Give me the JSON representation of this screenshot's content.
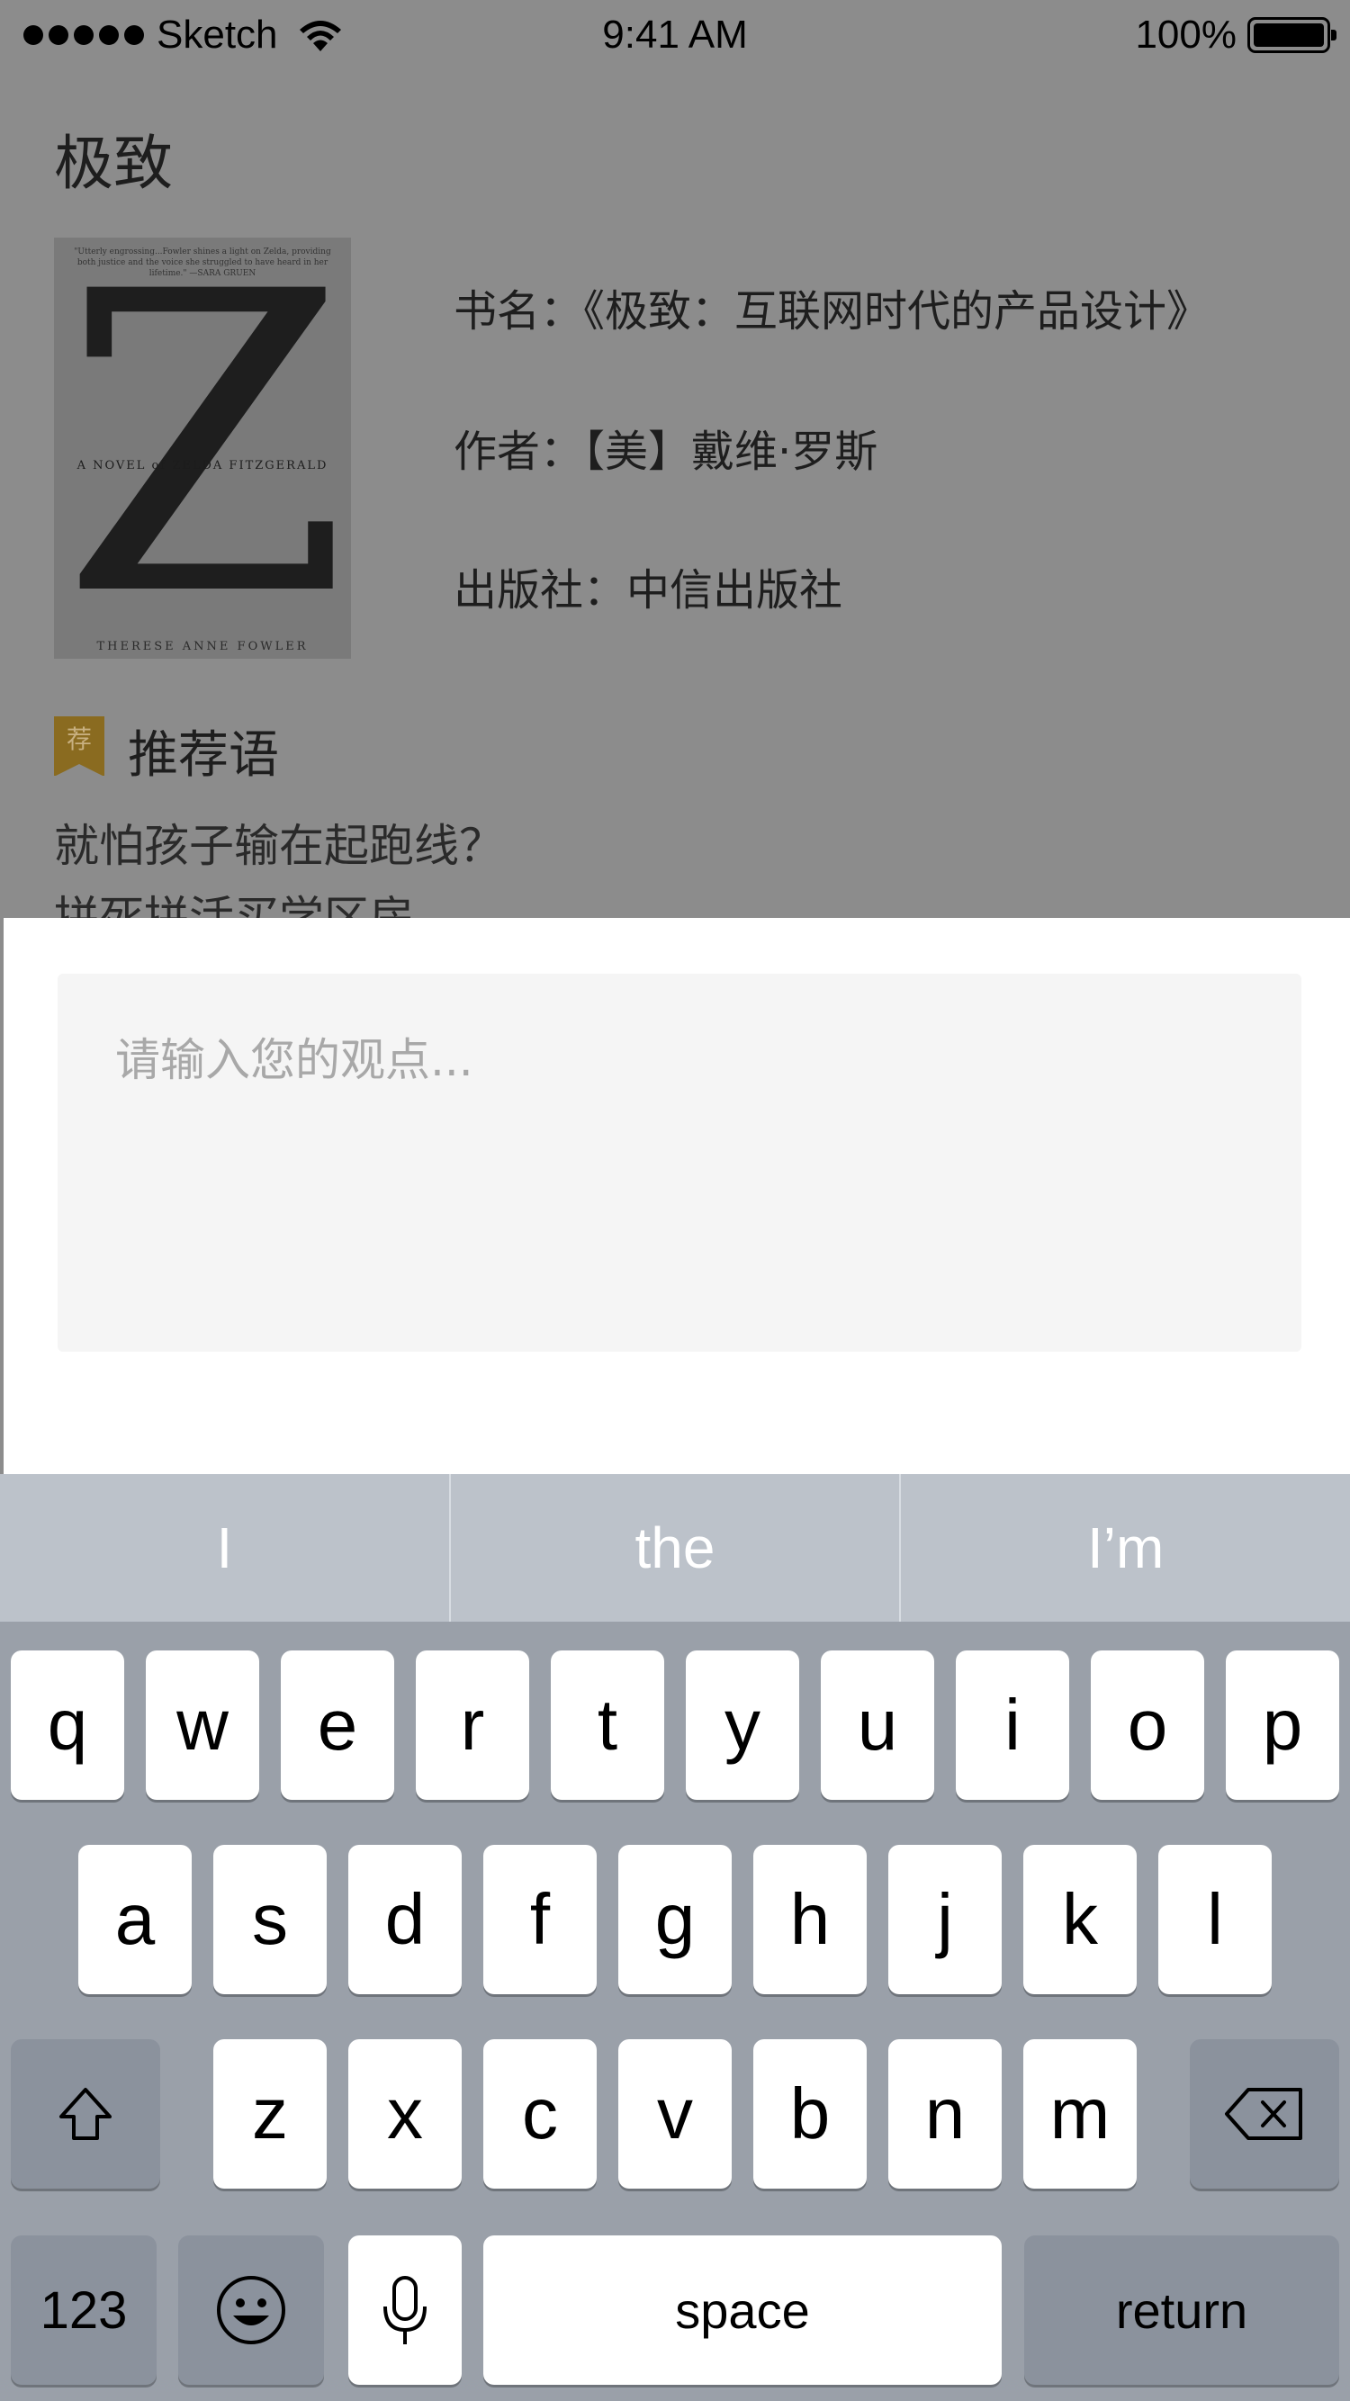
{
  "status_bar": {
    "carrier": "Sketch",
    "time": "9:41 AM",
    "battery": "100%"
  },
  "page": {
    "title": "极致",
    "cover": {
      "blurb": "\"Utterly engrossing...Fowler shines a light on Zelda, providing both justice and the voice she struggled to have heard in her lifetime.\" —SARA GRUEN",
      "letter": "Z",
      "series": "A NOVEL of ZELDA FITZGERALD",
      "author": "THERESE ANNE FOWLER"
    },
    "book_name": "书名：《极致：互联网时代的产品设计》",
    "author": "作者：【美】戴维·罗斯",
    "publisher": "出版社：中信出版社",
    "recommend_badge": "荐",
    "recommend_title": "推荐语",
    "recommend_line1": "就怕孩子输在起跑线？",
    "recommend_line2": "拼死拼活买学区房"
  },
  "comment": {
    "placeholder": "请输入您的观点..."
  },
  "keyboard": {
    "suggestions": [
      "I",
      "the",
      "I’m"
    ],
    "row1": [
      "q",
      "w",
      "e",
      "r",
      "t",
      "y",
      "u",
      "i",
      "o",
      "p"
    ],
    "row2": [
      "a",
      "s",
      "d",
      "f",
      "g",
      "h",
      "j",
      "k",
      "l"
    ],
    "row3": [
      "z",
      "x",
      "c",
      "v",
      "b",
      "n",
      "m"
    ],
    "numbers_label": "123",
    "space_label": "space",
    "return_label": "return"
  }
}
